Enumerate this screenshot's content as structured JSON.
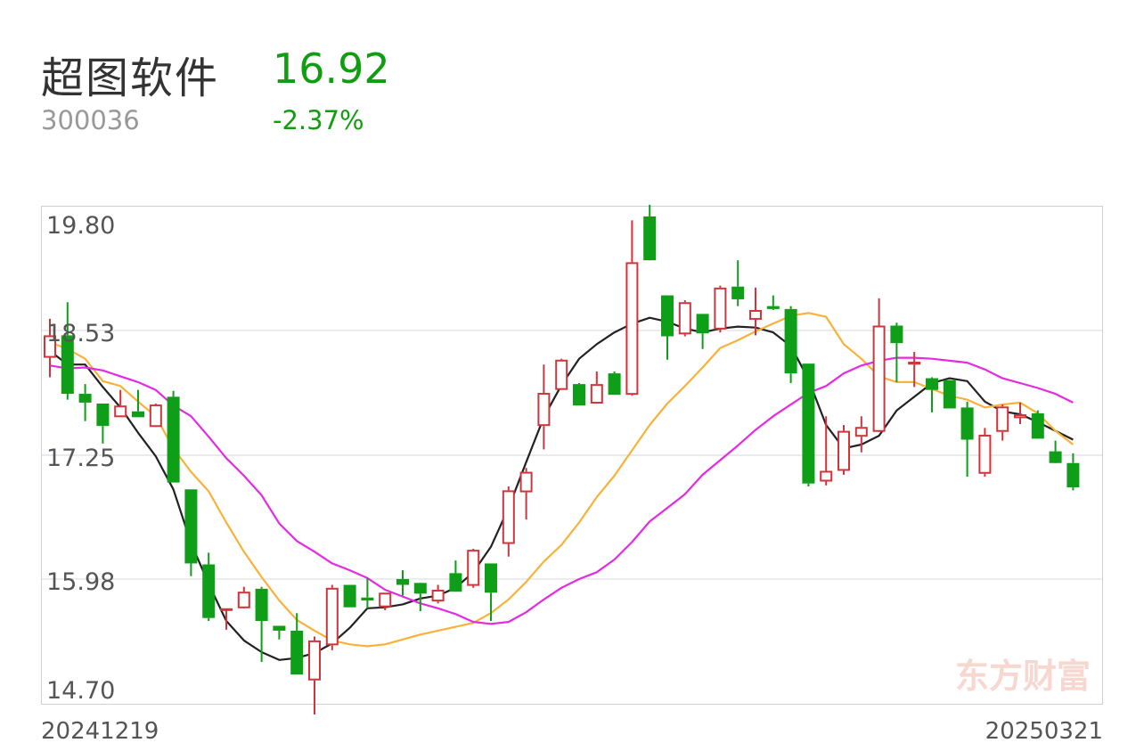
{
  "stock": {
    "name": "超图软件",
    "code": "300036",
    "price": "16.92",
    "change": "-2.37%",
    "trend_color": "#109e10"
  },
  "chart_data": {
    "type": "candlestick",
    "ylim": [
      14.7,
      19.8
    ],
    "y_ticks": [
      "19.80",
      "18.53",
      "17.25",
      "15.98",
      "14.70"
    ],
    "x_start_label": "20241219",
    "x_end_label": "20250321",
    "up_color": "#d0343c",
    "down_color": "#0e9e18",
    "watermark": "东方财富",
    "candles": [
      [
        18.25,
        18.48,
        18.05,
        18.65
      ],
      [
        18.48,
        17.88,
        17.82,
        18.82
      ],
      [
        17.88,
        17.79,
        17.6,
        17.98
      ],
      [
        17.78,
        17.55,
        17.37,
        17.78
      ],
      [
        17.64,
        17.76,
        17.64,
        17.92
      ],
      [
        17.7,
        17.64,
        17.64,
        17.92
      ],
      [
        17.54,
        17.77,
        17.55,
        17.78
      ],
      [
        17.85,
        16.97,
        16.97,
        17.91
      ],
      [
        16.9,
        16.14,
        16.01,
        16.9
      ],
      [
        16.13,
        15.58,
        15.55,
        16.25
      ],
      [
        15.68,
        15.68,
        15.46,
        15.68
      ],
      [
        15.68,
        15.85,
        15.7,
        15.9
      ],
      [
        15.88,
        15.55,
        15.13,
        15.9
      ],
      [
        15.5,
        15.45,
        15.36,
        15.48
      ],
      [
        15.45,
        15.0,
        15.0,
        15.63
      ],
      [
        14.94,
        15.35,
        14.59,
        15.39
      ],
      [
        15.3,
        15.89,
        15.25,
        15.92
      ],
      [
        15.92,
        15.69,
        15.69,
        15.92
      ],
      [
        15.79,
        15.76,
        15.68,
        15.99
      ],
      [
        15.69,
        15.84,
        15.66,
        15.84
      ],
      [
        15.98,
        15.92,
        15.81,
        16.07
      ],
      [
        15.94,
        15.83,
        15.65,
        15.93
      ],
      [
        15.75,
        15.87,
        15.73,
        15.92
      ],
      [
        16.04,
        15.85,
        15.92,
        16.17
      ],
      [
        15.91,
        16.28,
        15.89,
        16.29
      ],
      [
        16.14,
        15.84,
        15.55,
        16.14
      ],
      [
        16.34,
        16.89,
        16.21,
        16.93
      ],
      [
        16.87,
        17.08,
        16.59,
        17.12
      ],
      [
        17.55,
        17.89,
        17.31,
        18.18
      ],
      [
        17.92,
        18.23,
        17.92,
        18.24
      ],
      [
        17.98,
        17.76,
        17.76,
        17.99
      ],
      [
        17.78,
        17.98,
        17.96,
        18.11
      ],
      [
        18.09,
        17.87,
        17.87,
        18.11
      ],
      [
        17.87,
        19.23,
        17.86,
        19.66
      ],
      [
        19.7,
        19.25,
        19.27,
        19.82
      ],
      [
        18.89,
        18.47,
        18.23,
        18.74
      ],
      [
        18.49,
        18.82,
        18.47,
        18.84
      ],
      [
        18.7,
        18.5,
        18.34,
        18.7
      ],
      [
        18.54,
        18.97,
        18.51,
        18.99
      ],
      [
        18.98,
        18.85,
        18.78,
        19.25
      ],
      [
        18.64,
        18.74,
        18.48,
        18.97
      ],
      [
        18.78,
        18.75,
        18.74,
        18.89
      ],
      [
        18.75,
        18.09,
        17.99,
        18.78
      ],
      [
        18.19,
        16.96,
        16.93,
        18.19
      ],
      [
        16.98,
        17.09,
        16.94,
        17.65
      ],
      [
        17.09,
        17.5,
        17.05,
        17.56
      ],
      [
        17.44,
        17.54,
        17.28,
        17.65
      ],
      [
        17.49,
        18.58,
        17.53,
        18.86
      ],
      [
        18.58,
        18.4,
        18.0,
        18.61
      ],
      [
        18.18,
        18.21,
        17.95,
        18.31
      ],
      [
        18.04,
        17.92,
        17.69,
        18.05
      ],
      [
        18.02,
        17.73,
        17.74,
        17.84
      ],
      [
        17.74,
        17.41,
        17.03,
        17.8
      ],
      [
        17.06,
        17.46,
        17.03,
        17.53
      ],
      [
        17.49,
        17.75,
        17.4,
        17.77
      ],
      [
        17.63,
        17.67,
        17.57,
        17.79
      ],
      [
        17.68,
        17.42,
        17.51,
        17.71
      ],
      [
        17.29,
        17.17,
        17.2,
        17.4
      ],
      [
        17.17,
        16.92,
        16.89,
        17.27
      ]
    ],
    "series": [
      {
        "name": "",
        "color": "#222222",
        "values": [
          18.32,
          18.18,
          18.18,
          17.95,
          17.74,
          17.48,
          17.24,
          16.9,
          16.35,
          15.93,
          15.55,
          15.35,
          15.23,
          15.15,
          15.17,
          15.22,
          15.32,
          15.48,
          15.68,
          15.69,
          15.72,
          15.78,
          15.81,
          15.89,
          16.05,
          16.31,
          16.71,
          17.18,
          17.64,
          17.97,
          18.24,
          18.39,
          18.51,
          18.6,
          18.66,
          18.62,
          18.55,
          18.51,
          18.55,
          18.57,
          18.56,
          18.51,
          18.37,
          18.03,
          17.56,
          17.32,
          17.36,
          17.45,
          17.71,
          17.85,
          17.99,
          18.04,
          18.01,
          17.8,
          17.7,
          17.67,
          17.59,
          17.5,
          17.41
        ]
      },
      {
        "name": "",
        "color": "#f8b239",
        "values": [
          18.41,
          18.34,
          18.24,
          18.01,
          17.96,
          17.8,
          17.65,
          17.32,
          17.08,
          16.88,
          16.56,
          16.26,
          16.0,
          15.76,
          15.56,
          15.45,
          15.35,
          15.31,
          15.29,
          15.31,
          15.36,
          15.41,
          15.45,
          15.49,
          15.53,
          15.63,
          15.77,
          15.95,
          16.16,
          16.33,
          16.56,
          16.82,
          17.04,
          17.3,
          17.56,
          17.78,
          17.96,
          18.15,
          18.35,
          18.43,
          18.52,
          18.6,
          18.68,
          18.71,
          18.67,
          18.39,
          18.24,
          18.06,
          18.0,
          18.0,
          17.93,
          17.86,
          17.82,
          17.74,
          17.77,
          17.79,
          17.68,
          17.5,
          17.36
        ]
      },
      {
        "name": "",
        "color": "#e52ae3",
        "values": [
          18.17,
          18.14,
          18.15,
          18.12,
          18.06,
          18.0,
          17.92,
          17.76,
          17.65,
          17.44,
          17.22,
          17.04,
          16.84,
          16.55,
          16.37,
          16.26,
          16.14,
          16.07,
          15.99,
          15.87,
          15.8,
          15.73,
          15.68,
          15.62,
          15.54,
          15.52,
          15.54,
          15.64,
          15.77,
          15.89,
          15.98,
          16.05,
          16.18,
          16.36,
          16.57,
          16.71,
          16.85,
          17.05,
          17.2,
          17.35,
          17.51,
          17.65,
          17.77,
          17.89,
          17.96,
          18.09,
          18.17,
          18.22,
          18.25,
          18.25,
          18.24,
          18.22,
          18.2,
          18.13,
          18.04,
          17.99,
          17.94,
          17.88,
          17.79
        ]
      }
    ]
  }
}
